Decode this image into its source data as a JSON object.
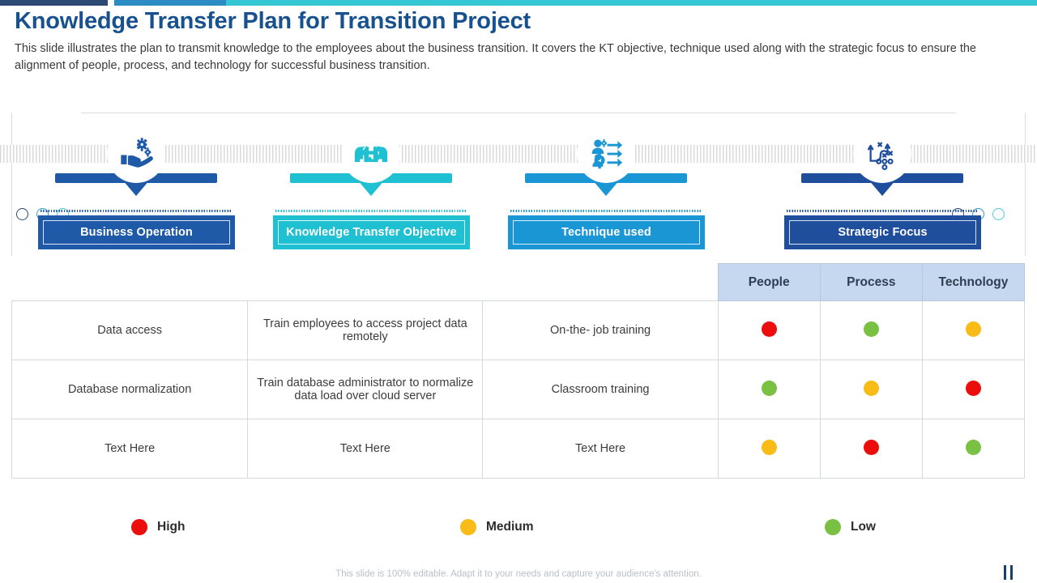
{
  "top_bars": {
    "colors": [
      "#2e4a74",
      "#2e8cc4",
      "#35c6d4"
    ]
  },
  "header": {
    "title": "Knowledge Transfer Plan for Transition Project",
    "subtitle": "This slide illustrates the plan to transmit knowledge to the employees about the business transition. It covers the KT objective, technique used along with the strategic focus to ensure the alignment of people, process, and technology for successful business transition.",
    "title_color": "#17528f"
  },
  "timeline_dots": {
    "left": [
      "navy",
      "blue",
      "cyan"
    ],
    "right": [
      "navy",
      "blue",
      "cyan"
    ]
  },
  "pillars": [
    {
      "label": "Business Operation",
      "color": "#1f5aa8",
      "icon": "hand-gears-icon"
    },
    {
      "label": "Knowledge Transfer Objective",
      "color": "#1ec0d1",
      "icon": "two-heads-gear-icon"
    },
    {
      "label": "Technique used",
      "color": "#1b96d4",
      "icon": "person-gear-arrows-icon"
    },
    {
      "label": "Strategic Focus",
      "color": "#1f4e9c",
      "icon": "strategy-playbook-icon"
    }
  ],
  "table": {
    "headers": [
      "",
      "",
      "",
      "People",
      "Process",
      "Technology"
    ],
    "rows": [
      {
        "topic": "Data access",
        "objective": "Train employees to access project data remotely",
        "technique": "On-the- job training",
        "people": "high",
        "process": "low",
        "technology": "medium"
      },
      {
        "topic": "Database normalization",
        "objective": "Train database administrator to normalize data load over cloud server",
        "technique": "Classroom training",
        "people": "low",
        "process": "medium",
        "technology": "high"
      },
      {
        "topic": "Text Here",
        "objective": "Text Here",
        "technique": "Text Here",
        "people": "medium",
        "process": "high",
        "technology": "low"
      }
    ]
  },
  "legend": [
    {
      "label": "High",
      "level": "high",
      "color": "#ec0d0d"
    },
    {
      "label": "Medium",
      "level": "medium",
      "color": "#f9bc16"
    },
    {
      "label": "Low",
      "level": "low",
      "color": "#7ac143"
    }
  ],
  "footer": {
    "note": "This slide is 100% editable. Adapt it to your needs and capture your audience's attention."
  }
}
